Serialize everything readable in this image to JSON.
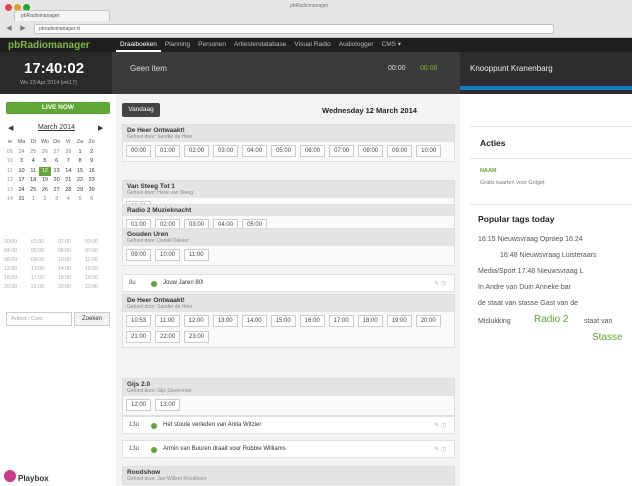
{
  "browser": {
    "tab_title": "pbRadiomanager",
    "window_title": "pbRadiomanager",
    "url": "pbradiomanager.nl"
  },
  "app": {
    "logo": "pbRadiomanager",
    "menu": [
      "Draaiboeken",
      "Planning",
      "Personen",
      "Artiestendatabase",
      "Visual Radio",
      "Audiologger",
      "CMS ▾"
    ],
    "active_menu_index": 0
  },
  "header": {
    "time": "17:40:02",
    "date": "Wo 23 Apr 2014 [wk17]",
    "now_item": "Geen item",
    "now_time": "00:00",
    "now_time_accent": "00:00",
    "now_program": "Knooppunt Kranenbarg"
  },
  "sidebar": {
    "live_label": "LIVE NOW",
    "calendar": {
      "month": "March 2014",
      "prev": "◀",
      "next": "▶",
      "header": [
        "w",
        "Ma",
        "Di",
        "Wo",
        "Do",
        "Vr",
        "Za",
        "Zo"
      ],
      "weeks": [
        [
          "09",
          "24",
          "25",
          "26",
          "27",
          "28",
          "1",
          "2"
        ],
        [
          "10",
          "3",
          "4",
          "5",
          "6",
          "7",
          "8",
          "9"
        ],
        [
          "11",
          "10",
          "11",
          "12",
          "13",
          "14",
          "15",
          "16"
        ],
        [
          "12",
          "17",
          "18",
          "19",
          "20",
          "21",
          "22",
          "23"
        ],
        [
          "13",
          "24",
          "25",
          "26",
          "27",
          "28",
          "29",
          "30"
        ],
        [
          "14",
          "31",
          "1",
          "2",
          "3",
          "4",
          "5",
          "6"
        ]
      ],
      "selected": "12"
    },
    "hours": [
      [
        "00:00",
        "01:00",
        "02:00",
        "03:00"
      ],
      [
        "04:00",
        "05:00",
        "06:00",
        "07:00"
      ],
      [
        "08:00",
        "09:00",
        "10:00",
        "11:00"
      ],
      [
        "12:00",
        "13:00",
        "14:00",
        "15:00"
      ],
      [
        "16:00",
        "17:00",
        "18:00",
        "19:00"
      ],
      [
        "20:00",
        "21:00",
        "22:00",
        "23:00"
      ]
    ],
    "search_placeholder": "Artiest / Cast",
    "search_button": "Zoeken",
    "sponsor": "Playbox"
  },
  "main": {
    "today_button": "Vandaag",
    "date_title": "Wednesday 12 March 2014",
    "sections": [
      {
        "title": "De Heer Ontwaakt!",
        "sub": "Gehost door: Sander de Heer",
        "slots": [
          "00:00",
          "01:00",
          "02:00",
          "03:00",
          "04:00",
          "05:00",
          "06:00",
          "07:00",
          "08:00",
          "09:00",
          "10:00"
        ]
      },
      {
        "title": "Van Steeg Tot 1",
        "sub": "Gehost door: Henk van Steeg",
        "slots": [
          "00:00"
        ]
      },
      {
        "title": "Radio 2 Muzieknacht",
        "sub": "",
        "slots": [
          "01:00",
          "02:00",
          "03:00",
          "04:00",
          "05:00"
        ]
      },
      {
        "title": "Gouden Uren",
        "sub": "Gehost door: Daniël Dekker",
        "slots": [
          "09:00",
          "10:00",
          "11:00"
        ]
      },
      {
        "title": "De Heer Ontwaakt!",
        "sub": "Gehost door: Sander de Heer",
        "slots": [
          "10:53",
          "11:00",
          "12:00",
          "13:00",
          "14:00",
          "15:00",
          "16:00",
          "17:00",
          "18:00",
          "19:00",
          "20:00",
          "21:00",
          "22:00",
          "23:00"
        ]
      },
      {
        "title": "Gijs 2.0",
        "sub": "Gehost door: Gijs Staverman",
        "slots": [
          "12:00",
          "13:00"
        ]
      },
      {
        "title": "Roodshow",
        "sub": "Gehost door: Jan-Willem Roodbeen",
        "slots": []
      }
    ],
    "items": [
      {
        "time": "8u",
        "text": "Jouw Jaren 80!"
      },
      {
        "time": "13u",
        "text": "Het stoute verleden van Anita Witzier"
      },
      {
        "time": "13u",
        "text": "Armin van Buuren draait voor Robbie Williams"
      }
    ]
  },
  "right": {
    "acties_title": "Acties",
    "naam_label": "NAAM",
    "gratis_text": "Gratis kaarten voor Golget",
    "tags_title": "Popular tags today",
    "tag_lines": [
      "16:15 Nieuwsvraag Oproep   16:24",
      "16:48 Nieuwsvraag Luisteraars",
      "Media/Sport   17:48 Nieuwsvraag L",
      "In   Andre van Duin   Anneke   bar",
      "de staat van stasse   Gast van de",
      "Mislukking"
    ],
    "tag_accent": "Radio 2",
    "tag_after": "staat van",
    "tag_last": "Stasse"
  },
  "colors": {
    "accent_green": "#5fa833",
    "progress_blue": "#0b7fc4"
  }
}
